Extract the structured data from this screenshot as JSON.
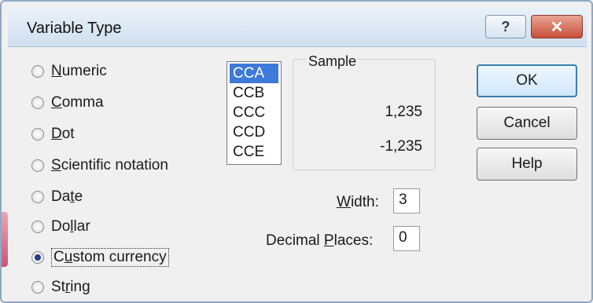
{
  "dialog": {
    "title": "Variable Type",
    "help_button": "?",
    "close_button": "✕"
  },
  "types": [
    {
      "pre": "",
      "key": "N",
      "post": "umeric",
      "checked": false
    },
    {
      "pre": "",
      "key": "C",
      "post": "omma",
      "checked": false
    },
    {
      "pre": "",
      "key": "D",
      "post": "ot",
      "checked": false
    },
    {
      "pre": "",
      "key": "S",
      "post": "cientific notation",
      "checked": false
    },
    {
      "pre": "Da",
      "key": "t",
      "post": "e",
      "checked": false
    },
    {
      "pre": "Do",
      "key": "l",
      "post": "lar",
      "checked": false
    },
    {
      "pre": "C",
      "key": "u",
      "post": "stom currency",
      "checked": true
    },
    {
      "pre": "St",
      "key": "r",
      "post": "ing",
      "checked": false
    }
  ],
  "currency_list": {
    "items": [
      "CCA",
      "CCB",
      "CCC",
      "CCD",
      "CCE"
    ],
    "selected": "CCA"
  },
  "sample": {
    "label": "Sample",
    "positive": "1,235",
    "negative": "-1,235"
  },
  "width": {
    "key": "W",
    "rest": "idth:",
    "value": "3"
  },
  "decimal": {
    "pre": "Decimal ",
    "key": "P",
    "rest": "laces:",
    "value": "0"
  },
  "buttons": {
    "ok": "OK",
    "cancel": "Cancel",
    "help": "Help"
  }
}
